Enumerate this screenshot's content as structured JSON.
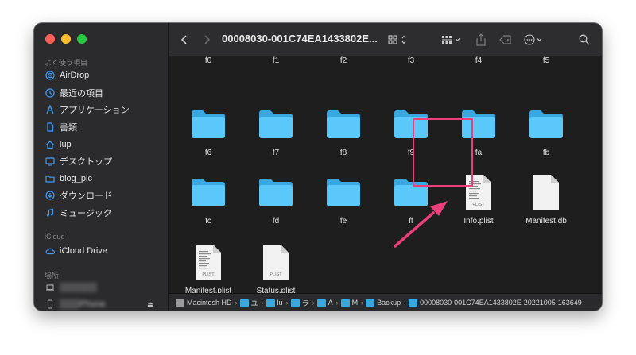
{
  "sidebar": {
    "favorites_title": "よく使う項目",
    "favorites": [
      {
        "label": "AirDrop",
        "icon": "airdrop-icon"
      },
      {
        "label": "最近の項目",
        "icon": "clock-icon"
      },
      {
        "label": "アプリケーション",
        "icon": "applications-icon"
      },
      {
        "label": "書類",
        "icon": "document-icon"
      },
      {
        "label": "lup",
        "icon": "home-icon"
      },
      {
        "label": "デスクトップ",
        "icon": "desktop-icon"
      },
      {
        "label": "blog_pic",
        "icon": "folder-icon"
      },
      {
        "label": "ダウンロード",
        "icon": "download-icon"
      },
      {
        "label": "ミュージック",
        "icon": "music-icon"
      }
    ],
    "icloud_title": "iCloud",
    "icloud_items": [
      {
        "label": "iCloud Drive",
        "icon": "cloud-icon"
      }
    ],
    "locations_title": "場所",
    "locations": [
      {
        "label": "▒▒▒▒▒▒",
        "icon": "laptop-icon"
      },
      {
        "label": "▒▒▒iPhone",
        "icon": "iphone-icon"
      }
    ]
  },
  "toolbar": {
    "title": "00008030-001C74EA1433802E..."
  },
  "content": {
    "top_row": [
      "f0",
      "f1",
      "f2",
      "f3",
      "f4",
      "f5"
    ],
    "row2": [
      "f6",
      "f7",
      "f8",
      "f9",
      "fa",
      "fb"
    ],
    "row3": [
      "fc",
      "fd",
      "fe",
      "ff",
      "Info.plist",
      "Manifest.db"
    ],
    "row4": [
      "Manifest.plist",
      "Status.plist"
    ],
    "doc_badge": "PLIST"
  },
  "pathbar": {
    "crumbs": [
      "Macintosh HD",
      "ユ",
      "lu",
      "ラ",
      "A",
      "M",
      "Backup",
      "00008030-001C74EA1433802E-20221005-163649"
    ]
  },
  "colors": {
    "folder": "#5ac8fa",
    "highlight": "#ea3f7b",
    "accent": "#3d9bf5"
  }
}
